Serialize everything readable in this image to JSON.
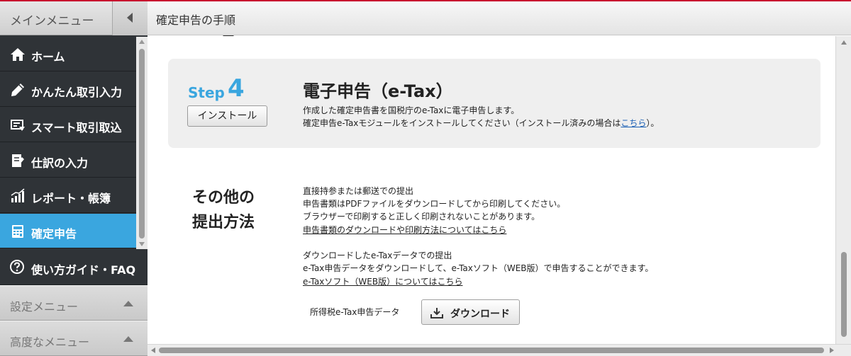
{
  "sidebar": {
    "title": "メインメニュー",
    "items": [
      {
        "label": "ホーム",
        "icon": "home-icon"
      },
      {
        "label": "かんたん取引入力",
        "icon": "pencil-icon"
      },
      {
        "label": "スマート取引取込",
        "icon": "import-icon"
      },
      {
        "label": "仕訳の入力",
        "icon": "journal-icon"
      },
      {
        "label": "レポート・帳簿",
        "icon": "chart-icon"
      },
      {
        "label": "確定申告",
        "icon": "calculator-icon",
        "active": true
      }
    ],
    "guide_label": "使い方ガイド・FAQ",
    "settings_menu": "設定メニュー",
    "advanced_menu": "高度なメニュー"
  },
  "header": {
    "title": "確定申告の手順"
  },
  "step": {
    "word": "Step",
    "number": "4",
    "install_button": "インストール",
    "title": "電子申告（e-Tax）",
    "desc1": "作成した確定申告書を国税庁のe-Taxに電子申告します。",
    "desc2_prefix": "確定申告e-Taxモジュールをインストールしてください（インストール済みの場合は",
    "desc2_link": "こちら",
    "desc2_suffix": "）。"
  },
  "other": {
    "title_line1": "その他の",
    "title_line2": "提出方法",
    "section1": {
      "heading": "直接持参または郵送での提出",
      "line1": "申告書類はPDFファイルをダウンロードしてから印刷してください。",
      "line2": "ブラウザーで印刷すると正しく印刷されないことがあります。",
      "link": "申告書類のダウンロードや印刷方法についてはこちら"
    },
    "section2": {
      "heading": "ダウンロードしたe-Taxデータでの提出",
      "line1": "e-Tax申告データをダウンロードして、e-Taxソフト（WEB版）で申告することができます。",
      "link": "e-Taxソフト（WEB版）についてはこちら"
    },
    "download_label": "所得税e-Tax申告データ",
    "download_button": "ダウンロード"
  },
  "colors": {
    "accent": "#3aa6df",
    "sidebar_bg": "#2f3337",
    "link": "#1a5fb4"
  }
}
